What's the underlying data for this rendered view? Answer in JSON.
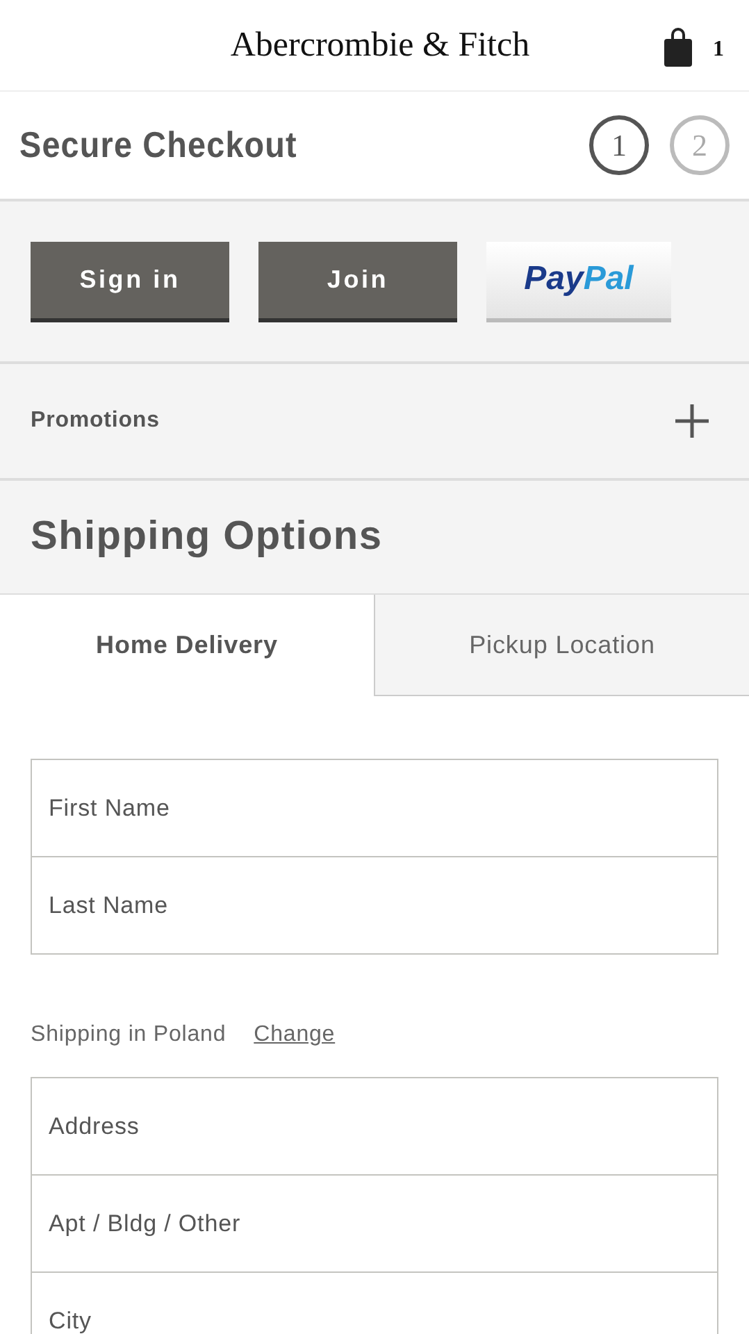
{
  "header": {
    "brand": "Abercrombie & Fitch",
    "cart_count": "1"
  },
  "checkout": {
    "title": "Secure Checkout",
    "steps": [
      {
        "label": "1",
        "selected": true
      },
      {
        "label": "2",
        "selected": false
      }
    ]
  },
  "account_buttons": [
    {
      "kind": "dark",
      "label": "Sign in"
    },
    {
      "kind": "dark",
      "label": "Join"
    },
    {
      "kind": "paypal",
      "parts": [
        "Pay",
        "Pal"
      ]
    }
  ],
  "promotions": {
    "label": "Promotions",
    "expanded": false
  },
  "shipping": {
    "title": "Shipping Options",
    "tabs": [
      {
        "label": "Home Delivery",
        "selected": true
      },
      {
        "label": "Pickup Location",
        "selected": false
      }
    ]
  },
  "name_fields": [
    {
      "placeholder": "First Name"
    },
    {
      "placeholder": "Last Name"
    }
  ],
  "shipping_country": {
    "text": "Shipping in Poland",
    "link": "Change"
  },
  "address_fields": [
    {
      "placeholder": "Address"
    },
    {
      "placeholder": "Apt / Bldg / Other"
    },
    {
      "placeholder": "City"
    }
  ]
}
